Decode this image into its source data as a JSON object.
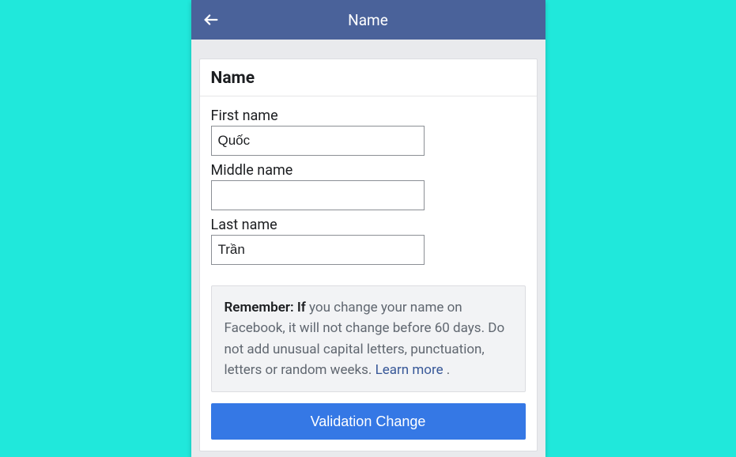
{
  "appbar": {
    "title": "Name"
  },
  "card": {
    "header": "Name"
  },
  "form": {
    "first_label": "First name",
    "first_value": "Quốc",
    "middle_label": "Middle name",
    "middle_value": "",
    "last_label": "Last name",
    "last_value": "Trần"
  },
  "notice": {
    "lead": "Remember: If",
    "body": " you change your name on Facebook, it will not change before 60 days. Do not add unusual capital letters, punctuation, letters or random weeks. ",
    "learn": "Learn more",
    "trail": " ."
  },
  "submit": {
    "label": "Validation Change"
  }
}
